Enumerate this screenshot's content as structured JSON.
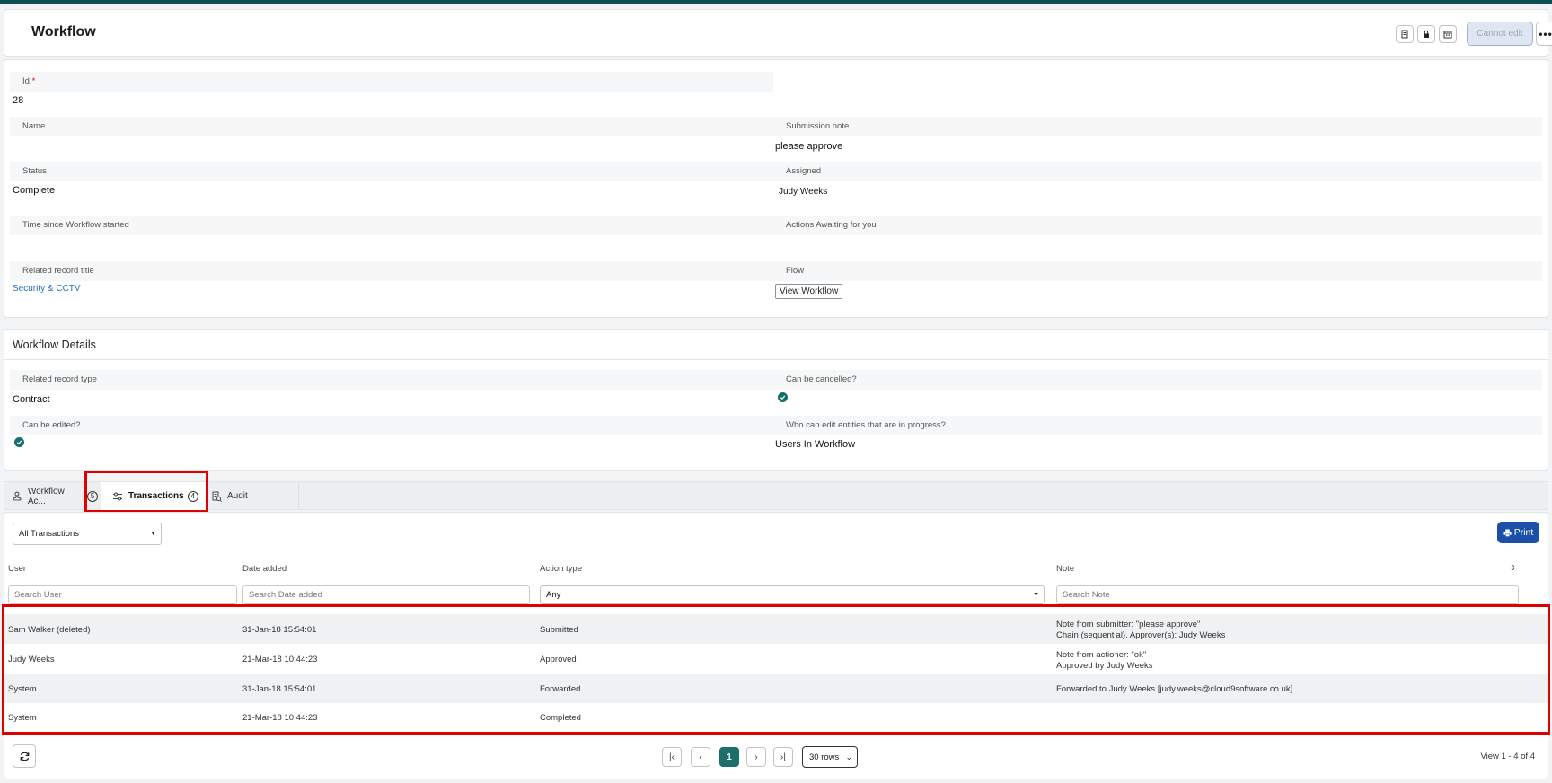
{
  "header": {
    "title": "Workflow",
    "icon_buttons": [
      "document-icon",
      "lock-icon",
      "calendar-icon"
    ],
    "cannot_edit_label": "Cannot edit",
    "more_label": "•••"
  },
  "form": {
    "id_label": "Id.",
    "id_required_marker": "*",
    "id_value": "28",
    "name_label": "Name",
    "name_value": "",
    "submission_note_label": "Submission note",
    "submission_note_value": "please approve",
    "status_label": "Status",
    "status_value": "Complete",
    "assigned_label": "Assigned",
    "assigned_value": "Judy Weeks",
    "time_since_label": "Time since Workflow started",
    "time_since_value": "",
    "actions_awaiting_label": "Actions Awaiting for you",
    "actions_awaiting_value": "",
    "related_title_label": "Related record title",
    "related_title_value": "Security & CCTV",
    "flow_label": "Flow",
    "view_workflow_label": "View Workflow"
  },
  "details": {
    "title": "Workflow Details",
    "related_type_label": "Related record type",
    "related_type_value": "Contract",
    "can_cancel_label": "Can be cancelled?",
    "can_cancel_value": true,
    "can_edit_label": "Can be edited?",
    "can_edit_value": true,
    "who_can_edit_label": "Who can edit entities that are in progress?",
    "who_can_edit_value": "Users In Workflow"
  },
  "tabs": [
    {
      "label": "Workflow Ac...",
      "badge": "5",
      "active": false
    },
    {
      "label": "Transactions",
      "badge": "4",
      "active": true
    },
    {
      "label": "Audit",
      "badge": "",
      "active": false
    }
  ],
  "transactions": {
    "filter_selected": "All Transactions",
    "print_label": "Print",
    "columns": [
      "User",
      "Date added",
      "Action type",
      "Note"
    ],
    "search": {
      "user_placeholder": "Search User",
      "date_placeholder": "Search Date added",
      "action_selected": "Any",
      "note_placeholder": "Search Note"
    },
    "rows": [
      {
        "user": "Sam Walker (deleted)",
        "date": "31-Jan-18 15:54:01",
        "action": "Submitted",
        "note1": "Note from submitter: \"please approve\"",
        "note2": "Chain (sequential). Approver(s): Judy Weeks"
      },
      {
        "user": "Judy Weeks",
        "date": "21-Mar-18 10:44:23",
        "action": "Approved",
        "note1": "Note from actioner: \"ok\"",
        "note2": "Approved by Judy Weeks"
      },
      {
        "user": "System",
        "date": "31-Jan-18 15:54:01",
        "action": "Forwarded",
        "note1": "Forwarded to Judy Weeks [judy.weeks@cloud9software.co.uk]",
        "note2": ""
      },
      {
        "user": "System",
        "date": "21-Mar-18 10:44:23",
        "action": "Completed",
        "note1": "",
        "note2": ""
      }
    ],
    "pager": {
      "current_page": "1",
      "rows_per_page": "30 rows",
      "view_count": "View 1 - 4 of 4"
    }
  },
  "colors": {
    "topbar": "#0e4f53",
    "accent_teal": "#1b6e6a",
    "print_blue": "#1b4fa8",
    "highlight_red": "#e00000",
    "link_blue": "#2a6fb8"
  }
}
